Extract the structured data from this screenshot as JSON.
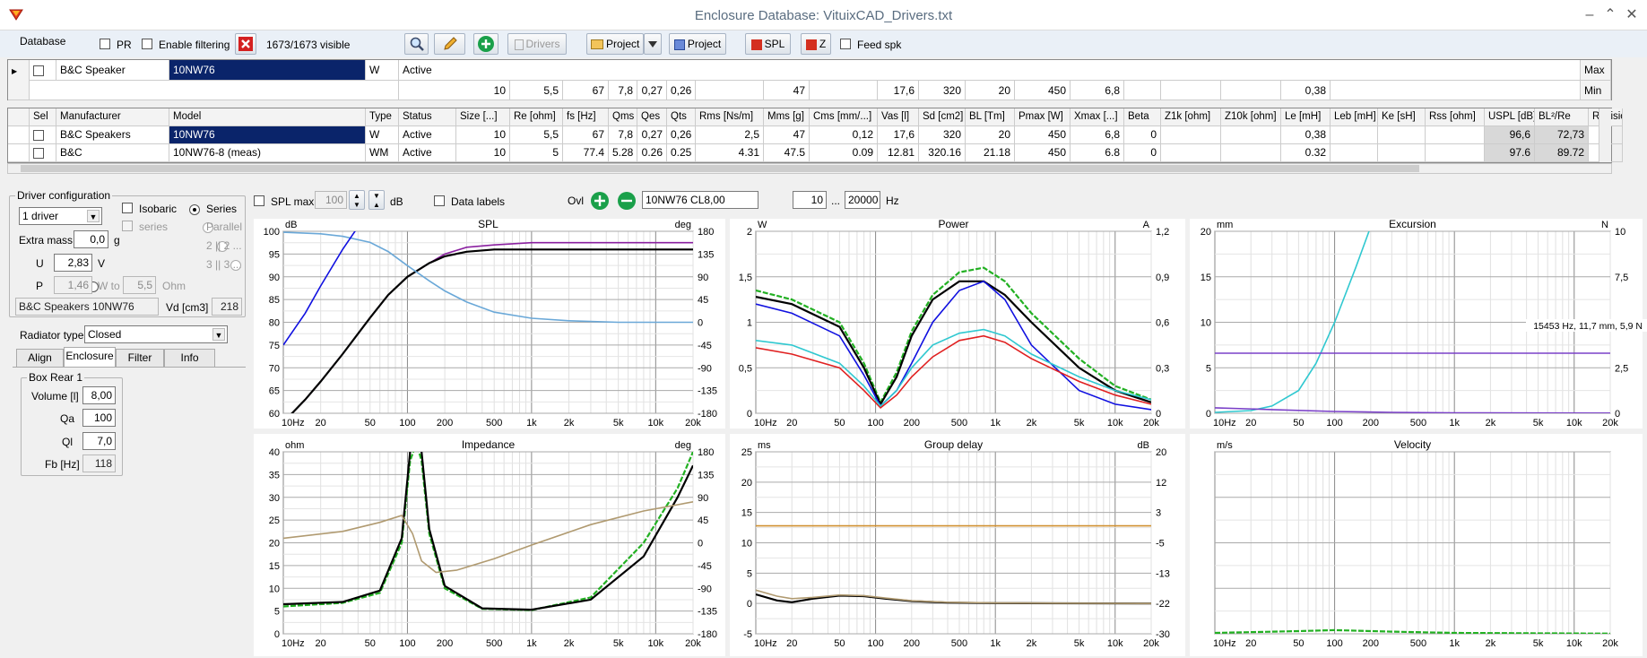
{
  "window": {
    "title": "Enclosure Database: VituixCAD_Drivers.txt",
    "min": "–",
    "max": "⌃",
    "close": "✕"
  },
  "toolbar": {
    "database": "Database",
    "pr": "PR",
    "enable_filtering": "Enable filtering",
    "visible": "1673/1673 visible",
    "drivers": "Drivers",
    "project1": "Project",
    "project2": "Project",
    "spl": "SPL",
    "z": "Z",
    "feed_spk": "Feed spk"
  },
  "filter_row": {
    "manufacturer": "B&C Speaker",
    "model": "10NW76",
    "type": "W",
    "status": "Active",
    "max": "Max",
    "min": "Min",
    "min_values": {
      "size": "10",
      "re": "5,5",
      "fs": "67",
      "qms": "7,8",
      "qes": "0,27",
      "qts": "0,26",
      "mms": "47",
      "vas": "17,6",
      "sd": "320",
      "bl": "20",
      "pmax": "450",
      "xmax": "6,8",
      "le": "0,38"
    }
  },
  "table": {
    "headers": [
      "Sel",
      "Manufacturer",
      "Model",
      "Type",
      "Status",
      "Size [...]",
      "Re [ohm]",
      "fs [Hz]",
      "Qms",
      "Qes",
      "Qts",
      "Rms [Ns/m]",
      "Mms [g]",
      "Cms [mm/...]",
      "Vas [l]",
      "Sd [cm2]",
      "BL [Tm]",
      "Pmax [W]",
      "Xmax [...]",
      "Beta",
      "Z1k [ohm]",
      "Z10k [ohm]",
      "Le [mH]",
      "Leb [mH]",
      "Ke [sH]",
      "Rss [ohm]",
      "USPL [dB]",
      "BL²/Re",
      "Revision"
    ],
    "rows": [
      [
        "",
        "B&C Speakers",
        "10NW76",
        "W",
        "Active",
        "10",
        "5,5",
        "67",
        "7,8",
        "0,27",
        "0,26",
        "2,5",
        "47",
        "0,12",
        "17,6",
        "320",
        "20",
        "450",
        "6,8",
        "0",
        "",
        "",
        "0,38",
        "",
        "",
        "",
        "96,6",
        "72,73",
        ""
      ],
      [
        "",
        "B&C",
        "10NW76-8 (meas)",
        "WM",
        "Active",
        "10",
        "5",
        "77.4",
        "5.28",
        "0.26",
        "0.25",
        "4.31",
        "47.5",
        "0.09",
        "12.81",
        "320.16",
        "21.18",
        "450",
        "6.8",
        "0",
        "",
        "",
        "0.32",
        "",
        "",
        "",
        "97.6",
        "89.72",
        ""
      ]
    ]
  },
  "driver_config": {
    "legend": "Driver configuration",
    "count": "1 driver",
    "isobaric": "Isobaric",
    "series_chk": "series",
    "series": "Series",
    "parallel": "Parallel",
    "opt2": "2 || 2 ...",
    "opt3": "3 || 3 ...",
    "extra_mass_label": "Extra mass",
    "extra_mass": "0,0",
    "g": "g",
    "u_label": "U",
    "u_value": "2,83",
    "v": "V",
    "p_label": "P",
    "p_value": "1,46",
    "w_to": "W to",
    "ohm_value": "5,5",
    "ohm": "Ohm",
    "driver_name": "B&C Speakers 10NW76",
    "vd_label": "Vd [cm3]",
    "vd": "218"
  },
  "radiator": {
    "label": "Radiator type",
    "value": "Closed"
  },
  "tabs": [
    "Align",
    "Enclosure",
    "Filter",
    "Info"
  ],
  "box": {
    "legend": "Box Rear 1",
    "volume_label": "Volume [l]",
    "volume": "8,00",
    "qa_label": "Qa",
    "qa": "100",
    "ql_label": "Ql",
    "ql": "7,0",
    "fb_label": "Fb [Hz]",
    "fb": "118"
  },
  "chart_toolbar": {
    "spl_max": "SPL max",
    "spl_max_value": "100",
    "db": "dB",
    "data_labels": "Data labels",
    "ovl": "Ovl",
    "ovl_name": "10NW76 CL8,00",
    "f_min": "10",
    "dots": "...",
    "f_max": "20000",
    "hz": "Hz"
  },
  "colors": {
    "black": "#000000",
    "green": "#22b022",
    "blue": "#1010e0",
    "red": "#e02020",
    "cyan": "#30c8d0",
    "purple": "#8a20a0",
    "lightblue": "#6aa8d8",
    "tan": "#b09a70",
    "orange": "#d09030",
    "violet": "#7a40c8"
  },
  "chart_data": [
    {
      "type": "line",
      "title": "SPL",
      "ylabel": "dB",
      "y2label": "deg",
      "x_ticks": [
        "10Hz",
        "20",
        "50",
        "100",
        "200",
        "500",
        "1k",
        "2k",
        "5k",
        "10k",
        "20k"
      ],
      "y_ticks": [
        "100",
        "95",
        "90",
        "85",
        "80",
        "75",
        "70",
        "65",
        "60"
      ],
      "y2_ticks": [
        "180",
        "135",
        "90",
        "45",
        "0",
        "-45",
        "-90",
        "-135",
        "-180"
      ],
      "ylim": [
        60,
        100
      ],
      "y2lim": [
        -180,
        180
      ],
      "series": [
        {
          "color": "purple",
          "x": [
            10,
            15,
            20,
            30,
            50,
            70,
            100,
            150,
            200,
            300,
            500,
            1000,
            2000,
            5000,
            10000,
            20000
          ],
          "y": [
            58,
            63,
            67,
            73,
            81,
            86,
            90,
            93,
            95,
            96.5,
            97,
            97.5,
            97.5,
            97.5,
            97.5,
            97.5
          ]
        },
        {
          "color": "black",
          "x": [
            10,
            15,
            20,
            30,
            50,
            70,
            100,
            150,
            200,
            300,
            500,
            1000,
            2000,
            5000,
            10000,
            20000
          ],
          "y": [
            58,
            63,
            67,
            73,
            81,
            86,
            90,
            93,
            94.5,
            95.5,
            96,
            96,
            96,
            96,
            96,
            96
          ]
        },
        {
          "color": "lightblue",
          "axis": "y2",
          "x": [
            10,
            20,
            30,
            50,
            70,
            100,
            150,
            200,
            300,
            500,
            1000,
            2000,
            5000,
            10000,
            20000
          ],
          "y": [
            178,
            175,
            170,
            158,
            140,
            112,
            82,
            62,
            40,
            20,
            8,
            3,
            0,
            0,
            0
          ]
        },
        {
          "color": "blue",
          "x": [
            10,
            15,
            20,
            30,
            40
          ],
          "y": [
            75,
            82,
            88,
            96,
            101
          ]
        }
      ]
    },
    {
      "type": "line",
      "title": "Power",
      "ylabel": "W",
      "y2label": "A",
      "x_ticks": [
        "10Hz",
        "20",
        "50",
        "100",
        "200",
        "500",
        "1k",
        "2k",
        "5k",
        "10k",
        "20k"
      ],
      "y_ticks": [
        "2",
        "1,5",
        "1",
        "0,5",
        "0"
      ],
      "y2_ticks": [
        "1,2",
        "0,9",
        "0,6",
        "0,3",
        "0"
      ],
      "ylim": [
        0,
        2
      ],
      "series": [
        {
          "color": "green",
          "x": [
            10,
            20,
            50,
            80,
            110,
            150,
            200,
            300,
            500,
            800,
            1200,
            2000,
            5000,
            10000,
            20000
          ],
          "y": [
            1.35,
            1.25,
            1.0,
            0.55,
            0.12,
            0.45,
            0.9,
            1.3,
            1.55,
            1.6,
            1.45,
            1.1,
            0.6,
            0.3,
            0.15
          ]
        },
        {
          "color": "black",
          "x": [
            10,
            20,
            50,
            80,
            110,
            150,
            200,
            300,
            500,
            800,
            1200,
            2000,
            5000,
            10000,
            20000
          ],
          "y": [
            1.28,
            1.2,
            0.95,
            0.5,
            0.1,
            0.4,
            0.85,
            1.25,
            1.45,
            1.45,
            1.3,
            1.0,
            0.5,
            0.25,
            0.12
          ]
        },
        {
          "color": "blue",
          "x": [
            10,
            20,
            50,
            80,
            110,
            150,
            200,
            300,
            500,
            800,
            1200,
            2000,
            5000,
            10000,
            20000
          ],
          "y": [
            1.2,
            1.1,
            0.85,
            0.42,
            0.08,
            0.25,
            0.55,
            1.0,
            1.35,
            1.45,
            1.25,
            0.75,
            0.25,
            0.1,
            0.04
          ]
        },
        {
          "color": "red",
          "x": [
            10,
            20,
            50,
            80,
            110,
            150,
            200,
            300,
            500,
            800,
            1200,
            2000,
            5000,
            10000,
            20000
          ],
          "y": [
            0.72,
            0.65,
            0.5,
            0.25,
            0.06,
            0.2,
            0.4,
            0.62,
            0.8,
            0.85,
            0.78,
            0.6,
            0.35,
            0.2,
            0.1
          ]
        },
        {
          "color": "cyan",
          "x": [
            10,
            20,
            50,
            80,
            110,
            150,
            200,
            300,
            500,
            800,
            1200,
            2000,
            5000,
            10000,
            20000
          ],
          "y": [
            0.8,
            0.75,
            0.55,
            0.3,
            0.08,
            0.25,
            0.5,
            0.75,
            0.88,
            0.92,
            0.85,
            0.65,
            0.4,
            0.25,
            0.15
          ]
        }
      ]
    },
    {
      "type": "line",
      "title": "Excursion",
      "ylabel": "mm",
      "y2label": "N",
      "x_ticks": [
        "10Hz",
        "20",
        "50",
        "100",
        "200",
        "500",
        "1k",
        "2k",
        "5k",
        "10k",
        "20k"
      ],
      "y_ticks": [
        "20",
        "15",
        "10",
        "5",
        "0"
      ],
      "y2_ticks": [
        "10",
        "7,5",
        "5",
        "2,5",
        "0"
      ],
      "ylim": [
        0,
        20
      ],
      "annotation": "15453 Hz, 11,7 mm, 5,9 N",
      "series": [
        {
          "color": "cyan",
          "x": [
            10,
            20,
            30,
            50,
            70,
            100,
            150,
            200
          ],
          "y": [
            0.1,
            0.3,
            0.8,
            2.5,
            5.5,
            10,
            16,
            20.5
          ]
        },
        {
          "color": "violet",
          "x": [
            10,
            20000
          ],
          "y": [
            6.6,
            6.6
          ]
        },
        {
          "color": "violet",
          "x": [
            10,
            30,
            100,
            300,
            1000,
            20000
          ],
          "y": [
            0.6,
            0.4,
            0.2,
            0.1,
            0.05,
            0.02
          ]
        }
      ]
    },
    {
      "type": "line",
      "title": "Impedance",
      "ylabel": "ohm",
      "y2label": "deg",
      "x_ticks": [
        "10Hz",
        "20",
        "50",
        "100",
        "200",
        "500",
        "1k",
        "2k",
        "5k",
        "10k",
        "20k"
      ],
      "y_ticks": [
        "40",
        "35",
        "30",
        "25",
        "20",
        "15",
        "10",
        "5",
        "0"
      ],
      "y2_ticks": [
        "180",
        "135",
        "90",
        "45",
        "0",
        "-45",
        "-90",
        "-135",
        "-180"
      ],
      "ylim": [
        0,
        40
      ],
      "series": [
        {
          "color": "green",
          "x": [
            10,
            30,
            60,
            90,
            105,
            118,
            130,
            150,
            200,
            400,
            1000,
            3000,
            8000,
            15000,
            20000
          ],
          "y": [
            6,
            6.8,
            9,
            20,
            38,
            42,
            38,
            22,
            10,
            5.5,
            5.2,
            8,
            20,
            32,
            40
          ]
        },
        {
          "color": "black",
          "x": [
            10,
            30,
            60,
            90,
            105,
            118,
            130,
            150,
            200,
            400,
            1000,
            3000,
            8000,
            15000,
            20000
          ],
          "y": [
            6.5,
            7,
            9.5,
            21,
            40,
            44,
            40,
            23,
            10.5,
            5.6,
            5.3,
            7.5,
            17,
            30,
            37
          ]
        },
        {
          "color": "tan",
          "x": [
            10,
            30,
            60,
            90,
            110,
            130,
            170,
            250,
            500,
            1000,
            3000,
            8000,
            20000
          ],
          "y": [
            21,
            22.5,
            24.5,
            26,
            22,
            16,
            13.5,
            14,
            16.5,
            19.5,
            24,
            27,
            29
          ]
        }
      ]
    },
    {
      "type": "line",
      "title": "Group delay",
      "ylabel": "ms",
      "y2label": "dB",
      "x_ticks": [
        "10Hz",
        "20",
        "50",
        "100",
        "200",
        "500",
        "1k",
        "2k",
        "5k",
        "10k",
        "20k"
      ],
      "y_ticks": [
        "25",
        "20",
        "15",
        "10",
        "5",
        "0",
        "-5"
      ],
      "y2_ticks": [
        "20",
        "12",
        "3",
        "-5",
        "-13",
        "-22",
        "-30"
      ],
      "ylim": [
        -5,
        25
      ],
      "series": [
        {
          "color": "orange",
          "x": [
            10,
            20000
          ],
          "y": [
            12.8,
            12.8
          ]
        },
        {
          "color": "black",
          "x": [
            10,
            15,
            20,
            30,
            50,
            80,
            120,
            200,
            400,
            1000,
            20000
          ],
          "y": [
            1.5,
            0.5,
            0.2,
            0.8,
            1.3,
            1.2,
            0.8,
            0.4,
            0.15,
            0.05,
            0
          ]
        },
        {
          "color": "tan",
          "x": [
            10,
            15,
            20,
            30,
            50,
            80,
            120,
            200,
            400,
            1000,
            20000
          ],
          "y": [
            2.2,
            1.2,
            0.8,
            1,
            1.4,
            1.3,
            0.9,
            0.45,
            0.2,
            0.08,
            0
          ]
        }
      ]
    },
    {
      "type": "line",
      "title": "Velocity",
      "ylabel": "m/s",
      "x_ticks": [
        "10Hz",
        "20",
        "50",
        "100",
        "200",
        "500",
        "1k",
        "2k",
        "5k",
        "10k",
        "20k"
      ],
      "y_ticks": [],
      "ylim": [
        0,
        10
      ],
      "series": [
        {
          "color": "green",
          "x": [
            10,
            50,
            100,
            300,
            1000,
            20000
          ],
          "y": [
            0.05,
            0.15,
            0.2,
            0.12,
            0.05,
            0.01
          ]
        }
      ]
    }
  ]
}
